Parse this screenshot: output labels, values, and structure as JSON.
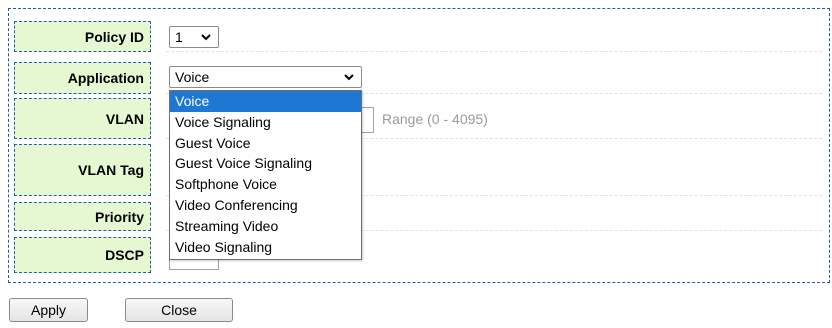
{
  "form": {
    "policy_id": {
      "label": "Policy ID",
      "value": "1"
    },
    "application": {
      "label": "Application",
      "value": "Voice",
      "options": [
        "Voice",
        "Voice Signaling",
        "Guest Voice",
        "Guest Voice Signaling",
        "Softphone Voice",
        "Video Conferencing",
        "Streaming Video",
        "Video Signaling"
      ]
    },
    "vlan": {
      "label": "VLAN",
      "range": "Range (0 - 4095)"
    },
    "vlan_tag": {
      "label": "VLAN Tag"
    },
    "priority": {
      "label": "Priority"
    },
    "dscp": {
      "label": "DSCP"
    }
  },
  "buttons": {
    "apply": "Apply",
    "close": "Close"
  },
  "colors": {
    "label_bg": "#e6f8d2",
    "border": "#1f5fa8",
    "highlight": "#1e77d3"
  }
}
